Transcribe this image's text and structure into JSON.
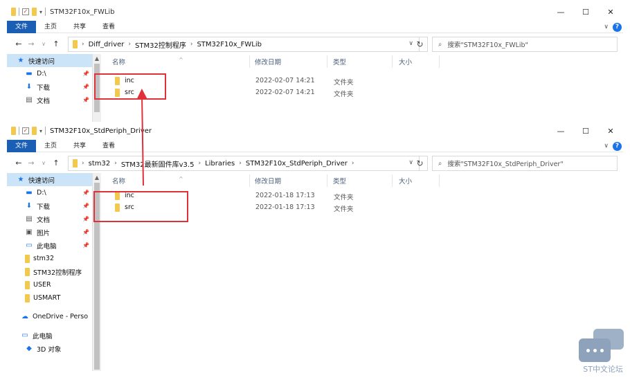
{
  "window1": {
    "title": "STM32F10x_FWLib",
    "ribbon_tabs": [
      "文件",
      "主页",
      "共享",
      "查看"
    ],
    "breadcrumb": [
      "Diff_driver",
      "STM32控制程序",
      "STM32F10x_FWLib"
    ],
    "search_placeholder": "搜索\"STM32F10x_FWLib\"",
    "quick_access": "快速访问",
    "sidebar": [
      "D:\\",
      "下载",
      "文档"
    ],
    "columns": [
      "名称",
      "修改日期",
      "类型",
      "大小"
    ],
    "files": [
      {
        "name": "inc",
        "date": "2022-02-07 14:21",
        "type": "文件夹"
      },
      {
        "name": "src",
        "date": "2022-02-07 14:21",
        "type": "文件夹"
      }
    ]
  },
  "window2": {
    "title": "STM32F10x_StdPeriph_Driver",
    "ribbon_tabs": [
      "文件",
      "主页",
      "共享",
      "查看"
    ],
    "breadcrumb": [
      "stm32",
      "STM32最新固件库v3.5",
      "Libraries",
      "STM32F10x_StdPeriph_Driver"
    ],
    "search_placeholder": "搜索\"STM32F10x_StdPeriph_Driver\"",
    "quick_access": "快速访问",
    "sidebar": [
      "D:\\",
      "下载",
      "文档",
      "图片",
      "此电脑",
      "stm32",
      "STM32控制程序",
      "USER",
      "USMART",
      "OneDrive - Perso",
      "此电脑",
      "3D 对象"
    ],
    "columns": [
      "名称",
      "修改日期",
      "类型",
      "大小"
    ],
    "files": [
      {
        "name": "inc",
        "date": "2022-01-18 17:13",
        "type": "文件夹"
      },
      {
        "name": "src",
        "date": "2022-01-18 17:13",
        "type": "文件夹"
      }
    ]
  },
  "watermark": {
    "text": "ST中文论坛"
  },
  "colors": {
    "accent": "#1a5fb4",
    "highlight": "#cce4f7",
    "annotation": "#e0303a",
    "folder": "#f2c94c"
  }
}
